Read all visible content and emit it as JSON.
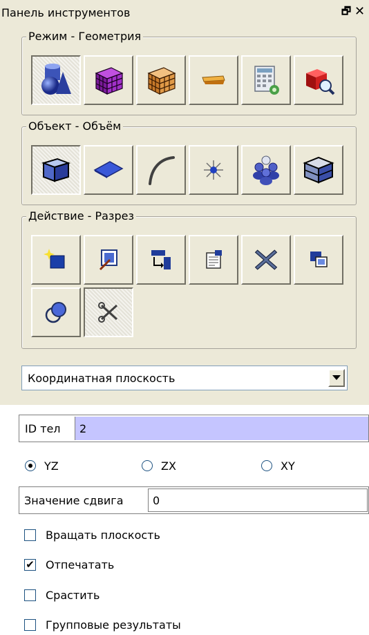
{
  "window": {
    "title": "Панель инструментов",
    "float_glyph": "🗗",
    "close_glyph": "✕"
  },
  "mode_group": {
    "legend": "Режим - Геометрия",
    "buttons": [
      "geometry-icon",
      "mesh-icon",
      "grid-cube-icon",
      "plank-icon",
      "calculator-icon",
      "inspect-cube-icon"
    ]
  },
  "object_group": {
    "legend": "Объект - Объём",
    "buttons": [
      "volume-cube-icon",
      "surface-icon",
      "curve-icon",
      "vertex-icon",
      "group-icon",
      "body-icon"
    ]
  },
  "action_group": {
    "legend": "Действие - Разрез",
    "buttons": [
      "create-icon",
      "edit-icon",
      "transform-icon",
      "properties-icon",
      "delete-icon",
      "copy-icon",
      "boolean-icon",
      "cut-icon"
    ]
  },
  "plane_select": {
    "value": "Координатная плоскость"
  },
  "body_id": {
    "label": "ID тел",
    "value": "2"
  },
  "axes": {
    "options": [
      "YZ",
      "ZX",
      "XY"
    ],
    "selected": "YZ"
  },
  "offset": {
    "label": "Значение сдвига",
    "value": "0"
  },
  "checkboxes": [
    {
      "label": "Вращать плоскость",
      "checked": false
    },
    {
      "label": "Отпечатать",
      "checked": true
    },
    {
      "label": "Срастить",
      "checked": false
    },
    {
      "label": "Групповые результаты",
      "checked": false
    }
  ],
  "colors": {
    "panel_bg": "#ece9d8",
    "field_highlight": "#c5c5ff"
  }
}
